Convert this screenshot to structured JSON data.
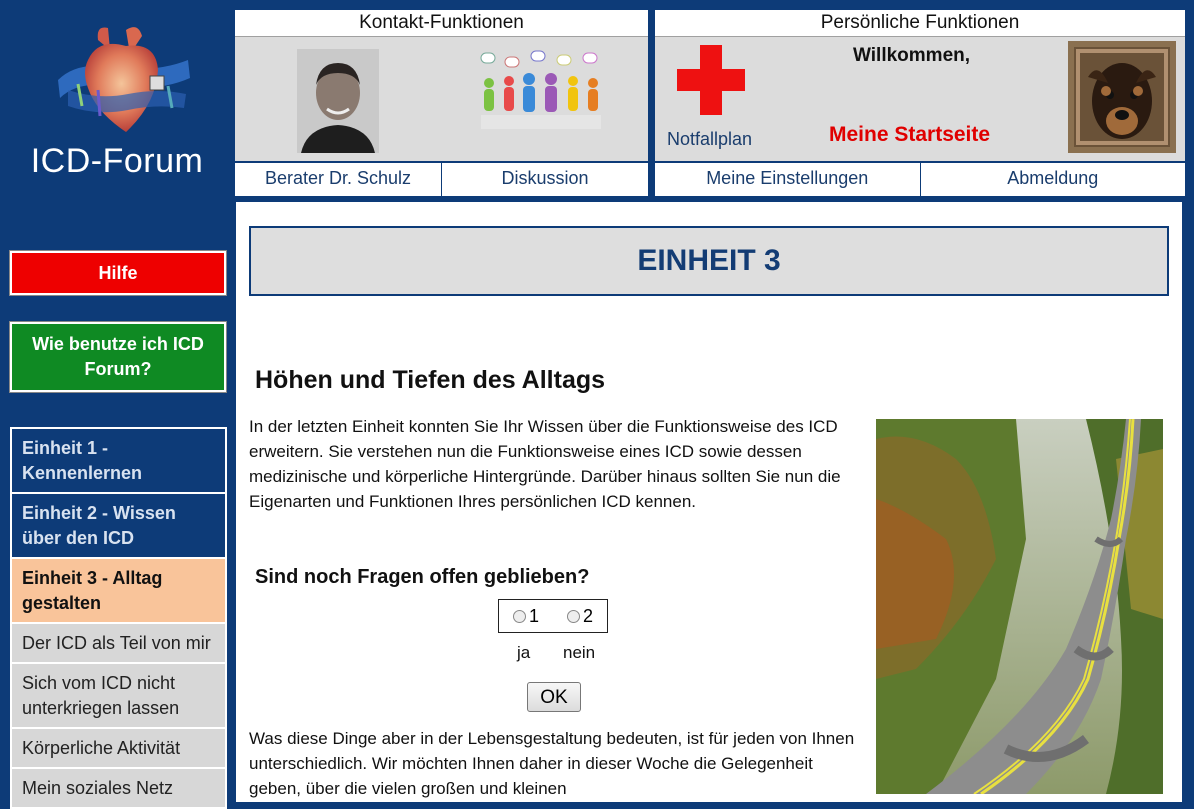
{
  "logo": {
    "title": "ICD-Forum"
  },
  "sidebar": {
    "help_label": "Hilfe",
    "howto_label": "Wie benutze ich ICD Forum?",
    "nav": [
      {
        "label": "Einheit 1 - Kennenlernen"
      },
      {
        "label": "Einheit 2 - Wissen über den ICD"
      },
      {
        "label": "Einheit 3 - Alltag gestalten"
      },
      {
        "label": "Der ICD als Teil von mir"
      },
      {
        "label": "Sich vom ICD nicht unterkriegen lassen"
      },
      {
        "label": "Körperliche Aktivität"
      },
      {
        "label": "Mein soziales Netz"
      }
    ]
  },
  "contact": {
    "title": "Kontakt-Funktionen",
    "link_advisor": "Berater Dr. Schulz",
    "link_discussion": "Diskussion"
  },
  "personal": {
    "title": "Persönliche Funktionen",
    "emergency_label": "Notfallplan",
    "welcome": "Willkommen,",
    "home_link": "Meine Startseite",
    "link_settings": "Meine Einstellungen",
    "link_logout": "Abmeldung"
  },
  "main": {
    "unit_title": "EINHEIT 3",
    "heading": "Höhen und Tiefen des Alltags",
    "intro": "In der letzten Einheit konnten Sie Ihr Wissen über die Funktionsweise des ICD erweitern. Sie verstehen nun die Funktionsweise eines ICD sowie dessen medizinische und körperliche Hintergründe. Darüber hinaus sollten Sie nun die Eigenarten und Funktionen Ihres persönlichen ICD kennen.",
    "question": "Sind noch Fragen offen geblieben?",
    "option1": "1",
    "option2": "2",
    "answer1": "ja",
    "answer2": "nein",
    "ok_label": "OK",
    "outro": "Was diese Dinge aber in der Lebensgestaltung bedeuten, ist für jeden von Ihnen unterschiedlich. Wir möchten Ihnen daher in dieser Woche die Gelegenheit geben, über die vielen großen und kleinen"
  },
  "colors": {
    "frame": "#0d3b78",
    "help": "#ee0000",
    "howto": "#0f8a23",
    "active_nav": "#f9c49a",
    "home_link": "#e00000"
  }
}
